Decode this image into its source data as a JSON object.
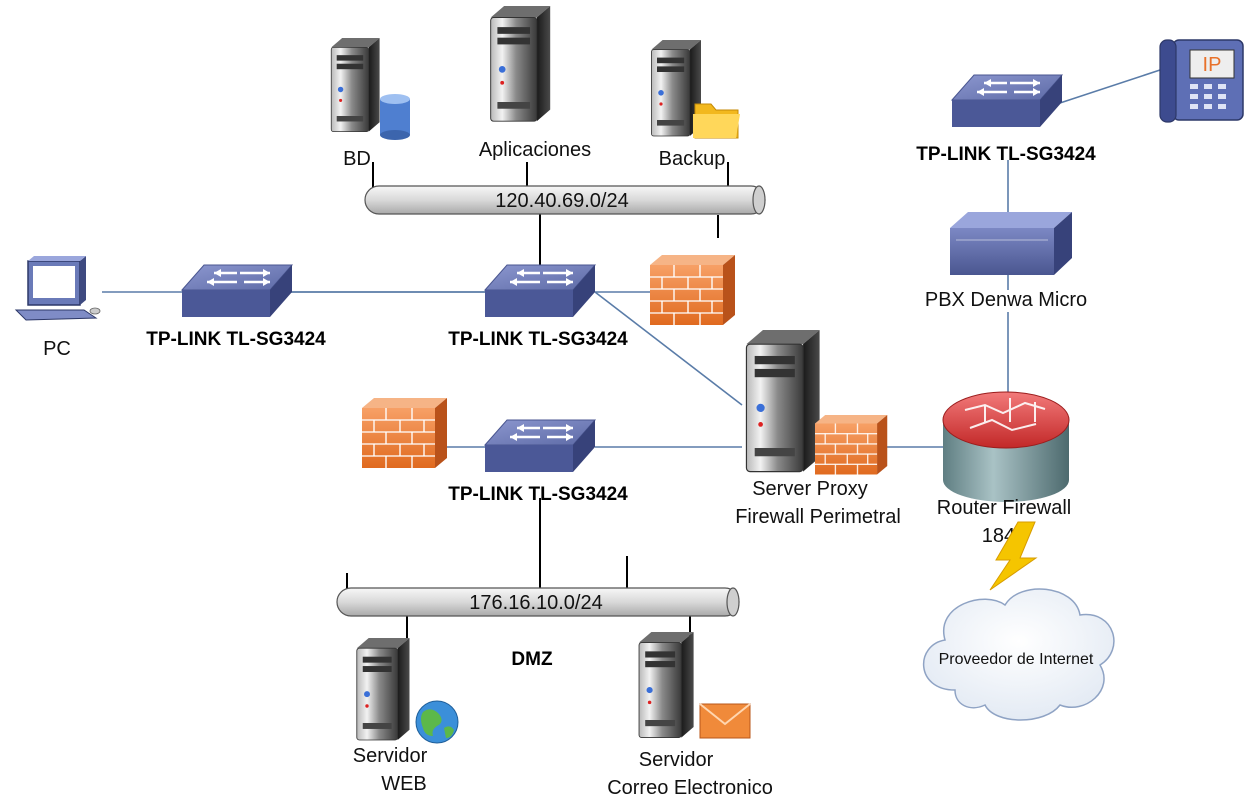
{
  "diagram": {
    "networks": {
      "internal": "120.40.69.0/24",
      "dmz_net": "176.16.10.0/24"
    },
    "zone_dmz": "DMZ",
    "servers": {
      "bd": "BD",
      "aplicaciones": "Aplicaciones",
      "backup": "Backup",
      "web_line1": "Servidor",
      "web_line2": "WEB",
      "mail_line1": "Servidor",
      "mail_line2": "Correo Electronico"
    },
    "switches": {
      "pc_switch": "TP-LINK TL-SG3424",
      "core_switch": "TP-LINK TL-SG3424",
      "dmz_switch": "TP-LINK TL-SG3424",
      "voip_switch": "TP-LINK TL-SG3424"
    },
    "pc": "PC",
    "pbx": "PBX Denwa Micro",
    "proxy_line1": "Server Proxy",
    "proxy_line2": "Firewall Perimetral",
    "router_line1": "Router Firewall",
    "router_line2": "1841",
    "isp": "Proveedor de Internet",
    "phone_badge": "IP"
  },
  "colors": {
    "link": "#5a7ca8",
    "switch_body": "#5d6aa6",
    "firewall": "#e8712a",
    "router": "#d93a3a",
    "tower": "#2b2b2b",
    "bus": "#e2e2e2",
    "lightning": "#f5c500"
  }
}
